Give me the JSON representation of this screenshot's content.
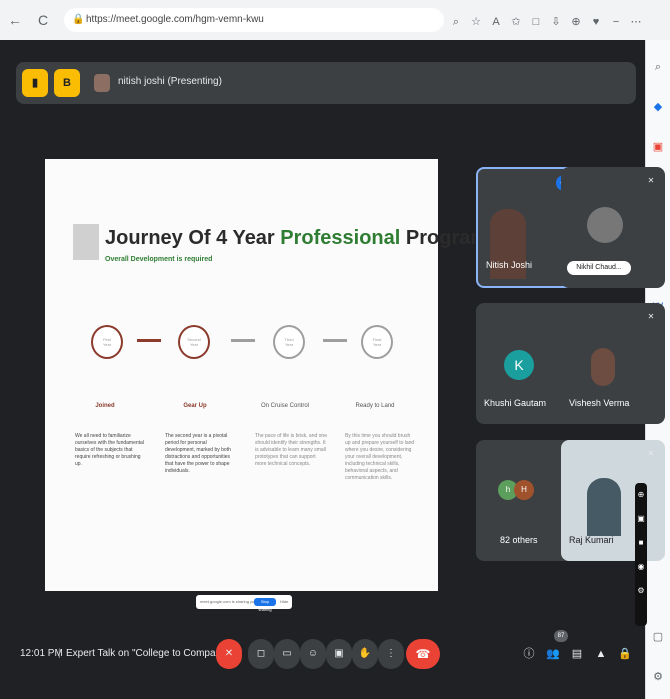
{
  "browser": {
    "back": "←",
    "reload": "C",
    "url": "https://meet.google.com/hgm-vemn-kwu",
    "icons": [
      "⌕",
      "☆",
      "A",
      "✩",
      "□",
      "⇩",
      "⊕",
      "♥",
      "−",
      "⋯"
    ]
  },
  "side_rail": {
    "icons": [
      "⌕",
      "◆",
      "▣",
      "▲",
      "●",
      "◉",
      "W",
      "+",
      "▢",
      "⚙"
    ]
  },
  "presenter_bar": {
    "btn1": "▮",
    "btn2": "B",
    "name": "nitish joshi (Presenting)"
  },
  "slide": {
    "title_part1": "Journey Of 4 Year ",
    "title_part2": "Professional",
    "title_part3": " Program",
    "subtitle": "Overall Development is required",
    "stages": [
      {
        "label": "Joined",
        "inner": "First Year",
        "desc": "We all need to familiarize ourselves with the fundamental basics of the subjects that require refreshing or brushing up."
      },
      {
        "label": "Gear Up",
        "inner": "Second Year",
        "desc": "The second year is a pivotal period for personal development, marked by both distractions and opportunities that have the power to shape individuals."
      },
      {
        "label": "On Cruise Control",
        "inner": "Third Year",
        "desc": "The pace of life is brisk, and one should identify their strengths. It is advisable to learn many small prototypes that can support more technical concepts."
      },
      {
        "label": "Ready to Land",
        "inner": "Final Year",
        "desc": "By this time you should brush up and prepare yourself to land where you desire, considering your overall development, including technical skills, behavioral aspects, and communication skills."
      }
    ]
  },
  "tooltip": {
    "text": "meet.google.com is sharing your screen.",
    "button": "Stop sharing",
    "hide": "Hide"
  },
  "participants": [
    {
      "name": "Nitish Joshi",
      "speaking_icon": "◖◗"
    },
    {
      "name": "Nikhil Chaud...",
      "mic_icon": "✕"
    },
    {
      "name": "Khushi Gautam",
      "initial": "K",
      "mic_icon": "✕",
      "color": "#1a9e9e"
    },
    {
      "name": "Vishesh Verma",
      "mic_icon": "✕"
    },
    {
      "name": "82 others",
      "initial_a": "h",
      "initial_b": "H"
    },
    {
      "name": "Raj Kumari",
      "mic_icon": "✕"
    }
  ],
  "bottom": {
    "time": "12:01 PM",
    "separator": "|",
    "meeting_title": "Expert Talk on \"College to Compan...",
    "controls": [
      "✕",
      "◻",
      "▭",
      "☺",
      "▣",
      "✋",
      "⋮"
    ],
    "end_call": "☎",
    "right_icons": [
      "ⓘ",
      "👥",
      "▤",
      "▲",
      "🔒"
    ],
    "participant_count": "87"
  },
  "float_controls": [
    "⊕",
    "▣",
    "■",
    "◉",
    "⚙"
  ]
}
